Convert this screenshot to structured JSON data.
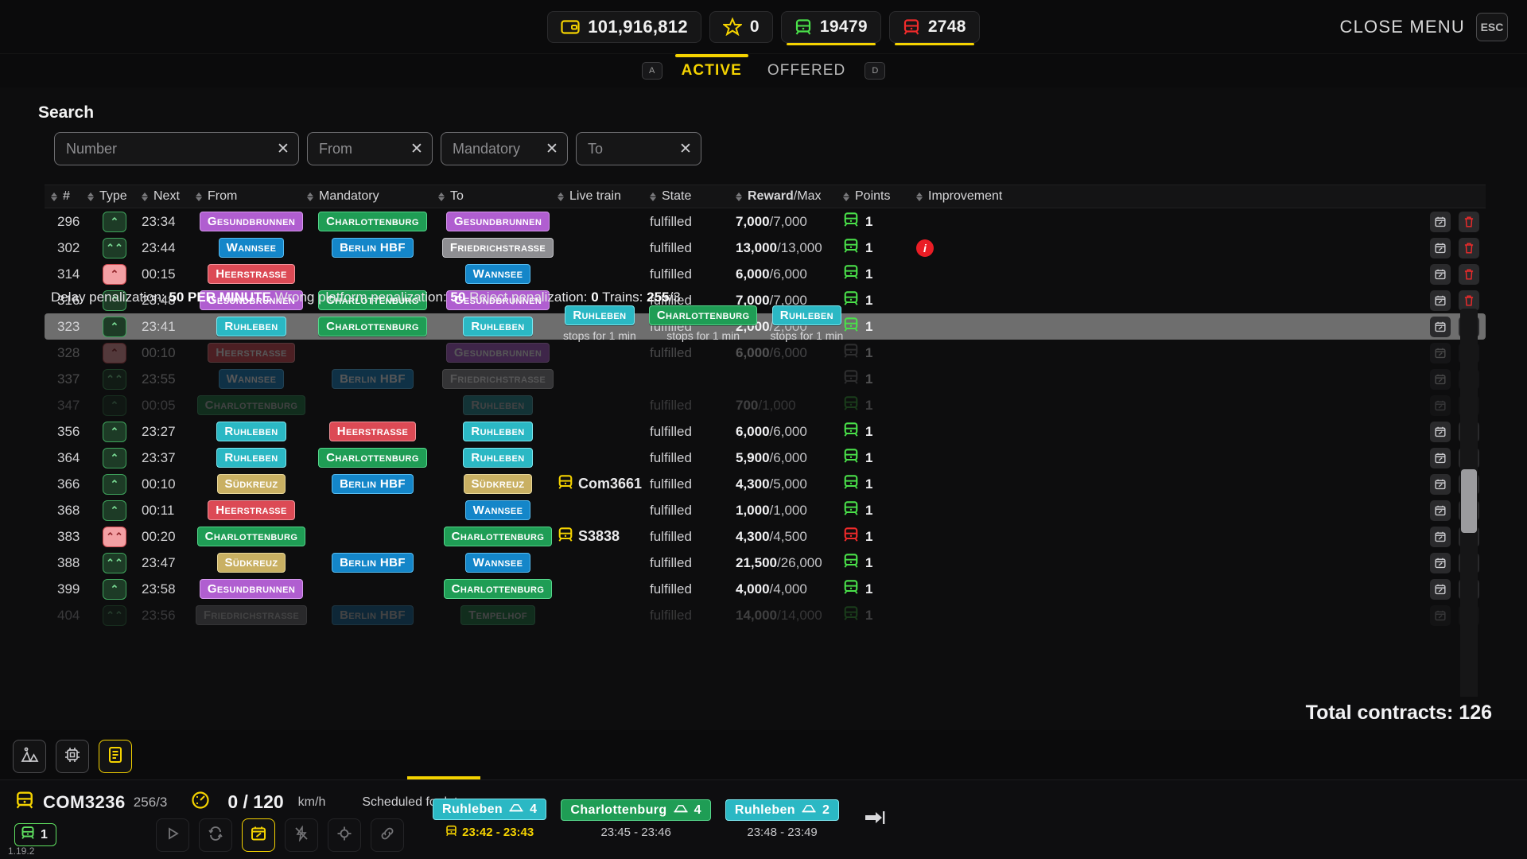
{
  "topbar": {
    "money": "101,916,812",
    "stars": "0",
    "trains_ok": "19479",
    "trains_bad": "2748",
    "close_menu_label": "CLOSE MENU",
    "esc_key": "ESC"
  },
  "tabs": {
    "active_key": "A",
    "offered_key": "D",
    "items": [
      {
        "label": "ACTIVE",
        "active": true
      },
      {
        "label": "OFFERED",
        "active": false
      }
    ]
  },
  "search": {
    "title": "Search",
    "fields": [
      {
        "name": "number",
        "placeholder": "Number",
        "value": ""
      },
      {
        "name": "from",
        "placeholder": "From",
        "value": ""
      },
      {
        "name": "mandatory",
        "placeholder": "Mandatory",
        "value": ""
      },
      {
        "name": "to",
        "placeholder": "To",
        "value": ""
      }
    ],
    "clear_glyph": "✕"
  },
  "table": {
    "headers": [
      "#",
      "Type",
      "Next",
      "From",
      "Mandatory",
      "To",
      "Live train",
      "State",
      "Reward/Max",
      "Points",
      "Improvement"
    ],
    "reward_header_bold": "Reward",
    "reward_header_rest": "/Max",
    "rows": [
      {
        "num": "296",
        "type": "up",
        "type_color": "green",
        "next": "23:34",
        "from": {
          "label": "Gesundbrunnen",
          "color": "purple"
        },
        "mandatory": {
          "label": "Charlottenburg",
          "color": "green"
        },
        "to": {
          "label": "Gesundbrunnen",
          "color": "purple"
        },
        "live": "",
        "state": "fulfilled",
        "reward": "7,000",
        "max": "7,000",
        "points": "1",
        "points_color": "green",
        "improvement": ""
      },
      {
        "num": "302",
        "type": "double",
        "type_color": "green",
        "next": "23:44",
        "from": {
          "label": "Wannsee",
          "color": "blue"
        },
        "mandatory": {
          "label": "Berlin HBF",
          "color": "blue"
        },
        "to": {
          "label": "Friedrichstraße",
          "color": "grey"
        },
        "live": "",
        "state": "fulfilled",
        "reward": "13,000",
        "max": "13,000",
        "points": "1",
        "points_color": "green",
        "improvement": "info"
      },
      {
        "num": "314",
        "type": "up",
        "type_color": "red",
        "next": "00:15",
        "from": {
          "label": "Heerstraße",
          "color": "red"
        },
        "mandatory": null,
        "to": {
          "label": "Wannsee",
          "color": "blue"
        },
        "live": "",
        "state": "fulfilled",
        "reward": "6,000",
        "max": "6,000",
        "points": "1",
        "points_color": "green",
        "improvement": ""
      },
      {
        "num": "316",
        "type": "up",
        "type_color": "green",
        "next": "23:48",
        "from": {
          "label": "Gesundbrunnen",
          "color": "purple"
        },
        "mandatory": {
          "label": "Charlottenburg",
          "color": "green"
        },
        "to": {
          "label": "Gesundbrunnen",
          "color": "purple"
        },
        "live": "",
        "state": "fulfilled",
        "reward": "7,000",
        "max": "7,000",
        "points": "1",
        "points_color": "green",
        "improvement": ""
      },
      {
        "num": "323",
        "type": "up",
        "type_color": "green",
        "next": "23:41",
        "from": {
          "label": "Ruhleben",
          "color": "cyan"
        },
        "mandatory": {
          "label": "Charlottenburg",
          "color": "green"
        },
        "to": {
          "label": "Ruhleben",
          "color": "cyan"
        },
        "live": "",
        "state": "fulfilled",
        "reward": "2,000",
        "max": "2,000",
        "points": "1",
        "points_color": "green",
        "improvement": "",
        "selected": true
      },
      {
        "num": "328",
        "type": "up",
        "type_color": "red",
        "next": "00:10",
        "from": {
          "label": "Heerstraße",
          "color": "red"
        },
        "mandatory": null,
        "to": {
          "label": "Gesundbrunnen",
          "color": "purple"
        },
        "live": "",
        "state": "fulfilled",
        "reward": "6,000",
        "max": "6,000",
        "points": "1",
        "points_color": "grey",
        "improvement": "",
        "dimmed": true
      },
      {
        "num": "337",
        "type": "double",
        "type_color": "green",
        "next": "23:55",
        "from": {
          "label": "Wannsee",
          "color": "blue"
        },
        "mandatory": {
          "label": "Berlin HBF",
          "color": "blue"
        },
        "to": {
          "label": "Friedrichstraße",
          "color": "grey"
        },
        "live": "",
        "state": "",
        "reward": "",
        "max": "",
        "points": "1",
        "points_color": "grey",
        "improvement": "",
        "dimmed": true
      },
      {
        "num": "347",
        "type": "up",
        "type_color": "green",
        "next": "00:05",
        "from": {
          "label": "Charlottenburg",
          "color": "green"
        },
        "mandatory": null,
        "to": {
          "label": "Ruhleben",
          "color": "cyan"
        },
        "live": "",
        "state": "fulfilled",
        "reward": "700",
        "max": "1,000",
        "points": "1",
        "points_color": "green",
        "improvement": "",
        "clipped": true
      },
      {
        "num": "356",
        "type": "up",
        "type_color": "green",
        "next": "23:27",
        "from": {
          "label": "Ruhleben",
          "color": "cyan"
        },
        "mandatory": {
          "label": "Heerstraße",
          "color": "red"
        },
        "to": {
          "label": "Ruhleben",
          "color": "cyan"
        },
        "live": "",
        "state": "fulfilled",
        "reward": "6,000",
        "max": "6,000",
        "points": "1",
        "points_color": "green",
        "improvement": ""
      },
      {
        "num": "364",
        "type": "up",
        "type_color": "green",
        "next": "23:37",
        "from": {
          "label": "Ruhleben",
          "color": "cyan"
        },
        "mandatory": {
          "label": "Charlottenburg",
          "color": "green"
        },
        "to": {
          "label": "Ruhleben",
          "color": "cyan"
        },
        "live": "",
        "state": "fulfilled",
        "reward": "5,900",
        "max": "6,000",
        "points": "1",
        "points_color": "green",
        "improvement": ""
      },
      {
        "num": "366",
        "type": "up",
        "type_color": "green",
        "next": "00:10",
        "from": {
          "label": "Südkreuz",
          "color": "sand"
        },
        "mandatory": {
          "label": "Berlin HBF",
          "color": "blue"
        },
        "to": {
          "label": "Südkreuz",
          "color": "sand"
        },
        "live": "Com3661",
        "state": "fulfilled",
        "reward": "4,300",
        "max": "5,000",
        "points": "1",
        "points_color": "green",
        "improvement": ""
      },
      {
        "num": "368",
        "type": "up",
        "type_color": "green",
        "next": "00:11",
        "from": {
          "label": "Heerstraße",
          "color": "red"
        },
        "mandatory": null,
        "to": {
          "label": "Wannsee",
          "color": "blue"
        },
        "live": "",
        "state": "fulfilled",
        "reward": "1,000",
        "max": "1,000",
        "points": "1",
        "points_color": "green",
        "improvement": ""
      },
      {
        "num": "383",
        "type": "double",
        "type_color": "red",
        "next": "00:20",
        "from": {
          "label": "Charlottenburg",
          "color": "green"
        },
        "mandatory": null,
        "to": {
          "label": "Charlottenburg",
          "color": "green"
        },
        "live": "S3838",
        "state": "fulfilled",
        "reward": "4,300",
        "max": "4,500",
        "points": "1",
        "points_color": "red",
        "improvement": ""
      },
      {
        "num": "388",
        "type": "double",
        "type_color": "green",
        "next": "23:47",
        "from": {
          "label": "Südkreuz",
          "color": "sand"
        },
        "mandatory": {
          "label": "Berlin HBF",
          "color": "blue"
        },
        "to": {
          "label": "Wannsee",
          "color": "blue"
        },
        "live": "",
        "state": "fulfilled",
        "reward": "21,500",
        "max": "26,000",
        "points": "1",
        "points_color": "green",
        "improvement": ""
      },
      {
        "num": "399",
        "type": "up",
        "type_color": "green",
        "next": "23:58",
        "from": {
          "label": "Gesundbrunnen",
          "color": "purple"
        },
        "mandatory": null,
        "to": {
          "label": "Charlottenburg",
          "color": "green"
        },
        "live": "",
        "state": "fulfilled",
        "reward": "4,000",
        "max": "4,000",
        "points": "1",
        "points_color": "green",
        "improvement": ""
      },
      {
        "num": "404",
        "type": "double",
        "type_color": "green",
        "next": "23:56",
        "from": {
          "label": "Friedrichstraße",
          "color": "grey"
        },
        "mandatory": {
          "label": "Berlin HBF",
          "color": "blue"
        },
        "to": {
          "label": "Tempelhof",
          "color": "green"
        },
        "live": "",
        "state": "fulfilled",
        "reward": "14,000",
        "max": "14,000",
        "points": "1",
        "points_color": "green",
        "improvement": "",
        "clipped": true
      }
    ],
    "row_action_edit": "calendar-edit",
    "row_action_delete": "trash"
  },
  "tooltip_penalization": {
    "delay_label": "Delay penalization:",
    "delay_value": "50 PER MINUTE",
    "platform_label": "Wrong platform penalization:",
    "platform_value": "50",
    "reject_label": "Reject penalization:",
    "reject_value": "0",
    "trains_label": "Trains:",
    "trains_value": "255",
    "trains_total": "/3"
  },
  "tooltip_stops": [
    {
      "station": "Ruhleben",
      "color": "cyan",
      "note": "stops for 1 min"
    },
    {
      "station": "Charlottenburg",
      "color": "green",
      "note": "stops for 1 min"
    },
    {
      "station": "Ruhleben",
      "color": "cyan",
      "note": "stops for 1 min"
    }
  ],
  "footer": {
    "total_contracts": "Total contracts: 126"
  },
  "tools": [
    {
      "name": "construction-icon",
      "active": false
    },
    {
      "name": "chip-icon",
      "active": false
    },
    {
      "name": "book-icon",
      "active": true
    }
  ],
  "train_panel": {
    "code": "COM3236",
    "fraction": "256/3",
    "speed": "0 / 120",
    "speed_unit": "km/h",
    "schedule_note": "Scheduled for later",
    "points": "1",
    "version": "1.19.2",
    "controls": [
      {
        "name": "play-button",
        "active": false
      },
      {
        "name": "loop-button",
        "active": false
      },
      {
        "name": "calendar-edit-button",
        "active": true
      },
      {
        "name": "no-bolt-button",
        "active": false
      },
      {
        "name": "target-button",
        "active": false
      },
      {
        "name": "link-button",
        "active": false
      }
    ],
    "stops": [
      {
        "station": "Ruhleben",
        "color": "cyan",
        "platform": "4",
        "time": "23:42 - 23:43",
        "current": true
      },
      {
        "station": "Charlottenburg",
        "color": "green",
        "platform": "4",
        "time": "23:45 - 23:46",
        "current": false
      },
      {
        "station": "Ruhleben",
        "color": "cyan",
        "platform": "2",
        "time": "23:48 - 23:49",
        "current": false
      }
    ]
  },
  "colors": {
    "accent": "#f5d300",
    "green": "#1f9d55",
    "red": "#dc4a55",
    "cyan": "#2bb8c4",
    "purple": "#b05ed0",
    "blue": "#1486c9",
    "sand": "#c9b063",
    "grey": "#8e8e92"
  }
}
